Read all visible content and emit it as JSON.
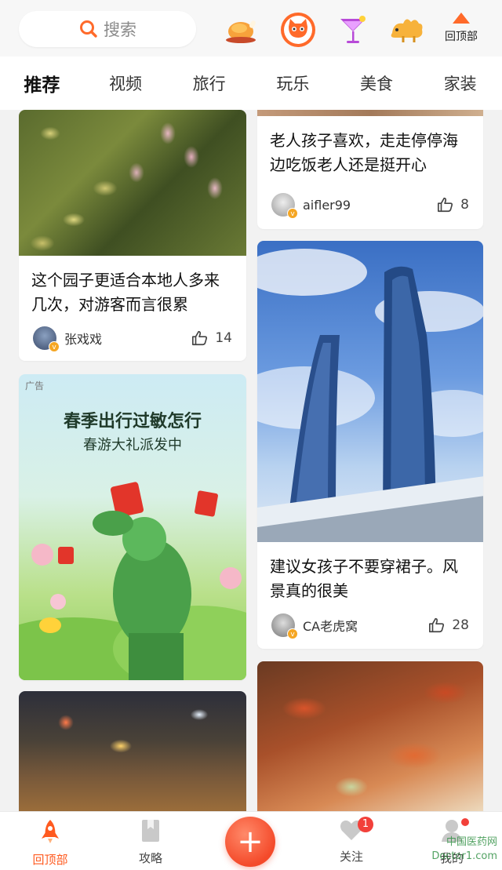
{
  "search": {
    "label": "搜索"
  },
  "back_to_top": {
    "label": "回顶部"
  },
  "tabs": [
    {
      "label": "推荐",
      "active": true
    },
    {
      "label": "视频"
    },
    {
      "label": "旅行"
    },
    {
      "label": "玩乐"
    },
    {
      "label": "美食"
    },
    {
      "label": "家装"
    }
  ],
  "posts": {
    "left_top": {
      "title": "这个园子更适合本地人多来几次，对游客而言很累",
      "author": "张戏戏",
      "likes": "14"
    },
    "right_top": {
      "title": "老人孩子喜欢，走走停停海边吃饭老人还是挺开心",
      "author": "aifler99",
      "likes": "8"
    },
    "right_mid": {
      "title": "建议女孩子不要穿裙子。风景真的很美",
      "author": "CA老虎窝",
      "likes": "28"
    }
  },
  "ad": {
    "tag": "广告",
    "title": "春季出行过敏怎行",
    "subtitle": "春游大礼派发中"
  },
  "bottom_nav": {
    "home": "回顶部",
    "guide": "攻略",
    "follow": "关注",
    "follow_badge": "1",
    "me": "我的"
  },
  "watermark": {
    "line1": "中国医药网",
    "line2": "Doctor1.com"
  },
  "colors": {
    "accent": "#ff5a1f",
    "fab": "#f44a2a",
    "badge": "#f2403a"
  }
}
